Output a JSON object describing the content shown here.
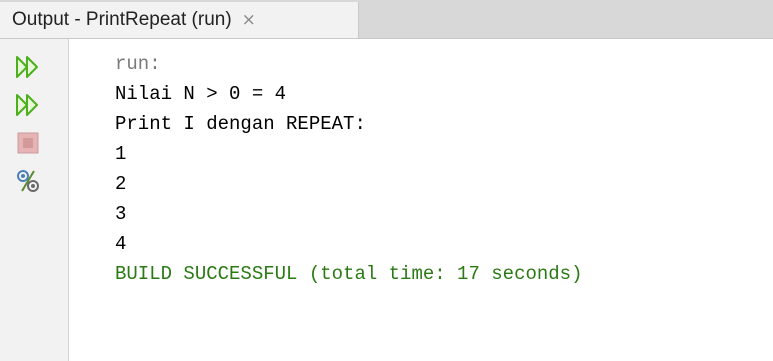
{
  "tab": {
    "title": "Output - PrintRepeat (run)",
    "close_glyph": "×"
  },
  "toolbar": {
    "buttons": [
      {
        "icon": "rerun-icon",
        "label": "Re-run"
      },
      {
        "icon": "rerun-with-options-icon",
        "label": "Re-run with options"
      },
      {
        "icon": "stop-icon",
        "label": "Stop"
      },
      {
        "icon": "settings-icon",
        "label": "Settings"
      }
    ]
  },
  "console": {
    "lines": [
      {
        "text": "run:",
        "style": "gray"
      },
      {
        "text": "Nilai N > 0 = 4",
        "style": "black"
      },
      {
        "text": "Print I dengan REPEAT:",
        "style": "black"
      },
      {
        "text": "1",
        "style": "black"
      },
      {
        "text": "2",
        "style": "black"
      },
      {
        "text": "3",
        "style": "black"
      },
      {
        "text": "4",
        "style": "black"
      },
      {
        "text": "BUILD SUCCESSFUL (total time: 17 seconds)",
        "style": "green"
      }
    ]
  },
  "colors": {
    "success": "#2a7a14",
    "run_label": "#7a7a7a",
    "icon_green": "#4caf1e"
  }
}
